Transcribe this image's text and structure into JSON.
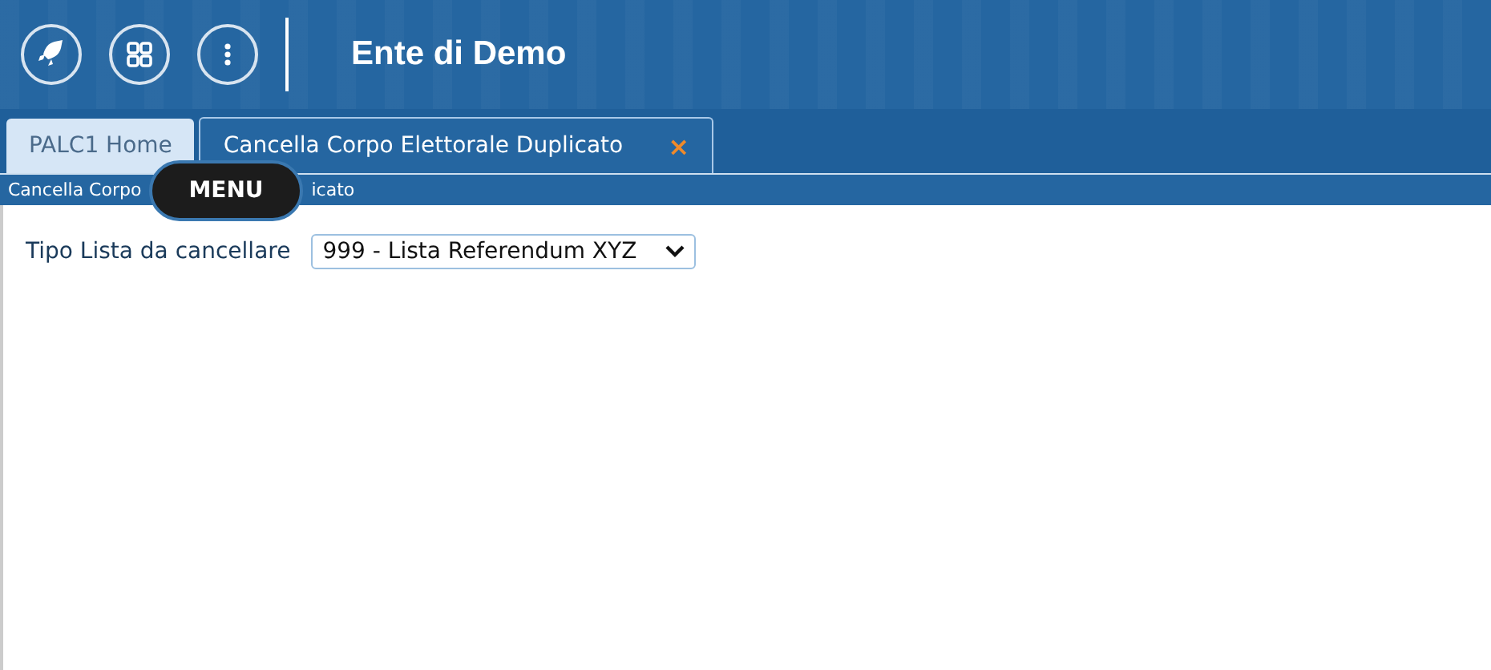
{
  "header": {
    "title": "Ente di Demo"
  },
  "tabs": [
    {
      "label": "PALC1 Home",
      "selected": false
    },
    {
      "label": "Cancella Corpo Elettorale Duplicato",
      "selected": true,
      "close": "×"
    }
  ],
  "tooltip": "MENU",
  "breadcrumb": [
    "Cancella Corpo",
    "icato"
  ],
  "form": {
    "label": "Tipo Lista da cancellare",
    "value": "999 - Lista Referendum XYZ"
  }
}
